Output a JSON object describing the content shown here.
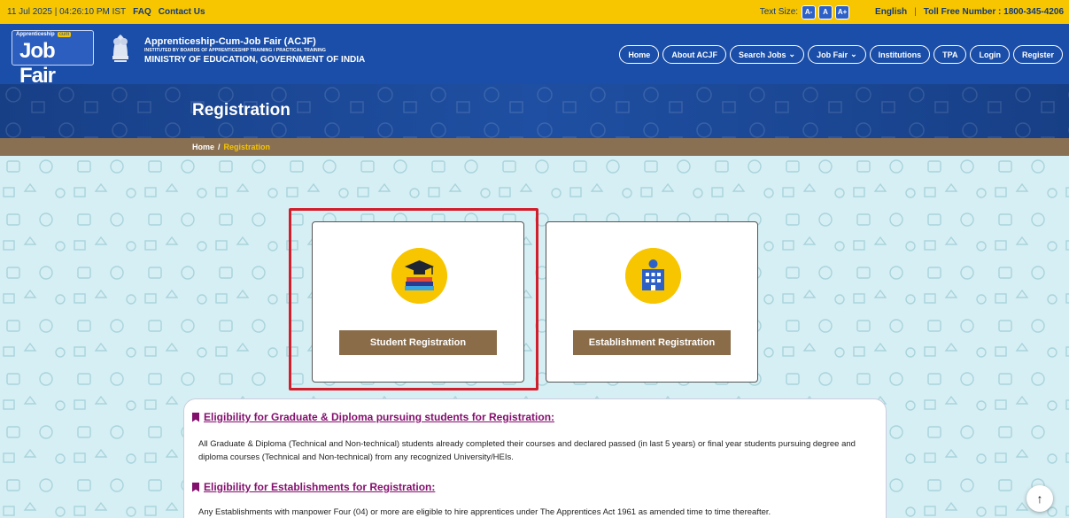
{
  "topbar": {
    "datetime": "11 Jul 2025 | 04:26:10 PM IST",
    "faq": "FAQ",
    "contact": "Contact Us",
    "text_size_label": "Text Size:",
    "ts_small": "A-",
    "ts_normal": "A",
    "ts_large": "A+",
    "language": "English",
    "toll_free": "Toll Free Number : 1800-345-4206"
  },
  "header": {
    "logo_top": "Apprenticeship",
    "logo_cum": "cum",
    "logo_main": "Job Fair",
    "title": "Apprenticeship-Cum-Job Fair (ACJF)",
    "subtitle": "INSTITUTED BY BOARDS OF APPRENTICESHIP TRAINING / PRACTICAL TRAINING",
    "ministry": "MINISTRY OF EDUCATION, GOVERNMENT OF INDIA",
    "nav": [
      {
        "label": "Home"
      },
      {
        "label": "About ACJF"
      },
      {
        "label": "Search Jobs",
        "dropdown": true
      },
      {
        "label": "Job Fair",
        "dropdown": true
      },
      {
        "label": "Institutions"
      },
      {
        "label": "TPA"
      },
      {
        "label": "Login"
      },
      {
        "label": "Register"
      }
    ]
  },
  "banner": {
    "title": "Registration"
  },
  "breadcrumb": {
    "home": "Home",
    "separator": "/",
    "current": "Registration"
  },
  "cards": {
    "student": {
      "label": "Student Registration",
      "icon": "graduation-books-icon"
    },
    "establishment": {
      "label": "Establishment Registration",
      "icon": "building-icon"
    }
  },
  "info": {
    "heading1": "Eligibility for Graduate & Diploma pursuing students for Registration:",
    "text1": "All Graduate & Diploma (Technical and Non-technical) students already completed their courses and declared passed (in last 5 years) or final year students pursuing degree and diploma courses (Technical and Non-technical) from any recognized University/HEIs.",
    "heading2": "Eligibility for Establishments for Registration:",
    "text2": "Any Establishments with manpower Four (04) or more are eligible to hire apprentices under The Apprentices Act 1961 as amended time to time thereafter."
  },
  "colors": {
    "topbar": "#f7c600",
    "header": "#1a4ea8",
    "card_button": "#8a6c49",
    "highlight": "#d21d2b",
    "heading": "#84106e"
  },
  "scroll_top": "↑"
}
